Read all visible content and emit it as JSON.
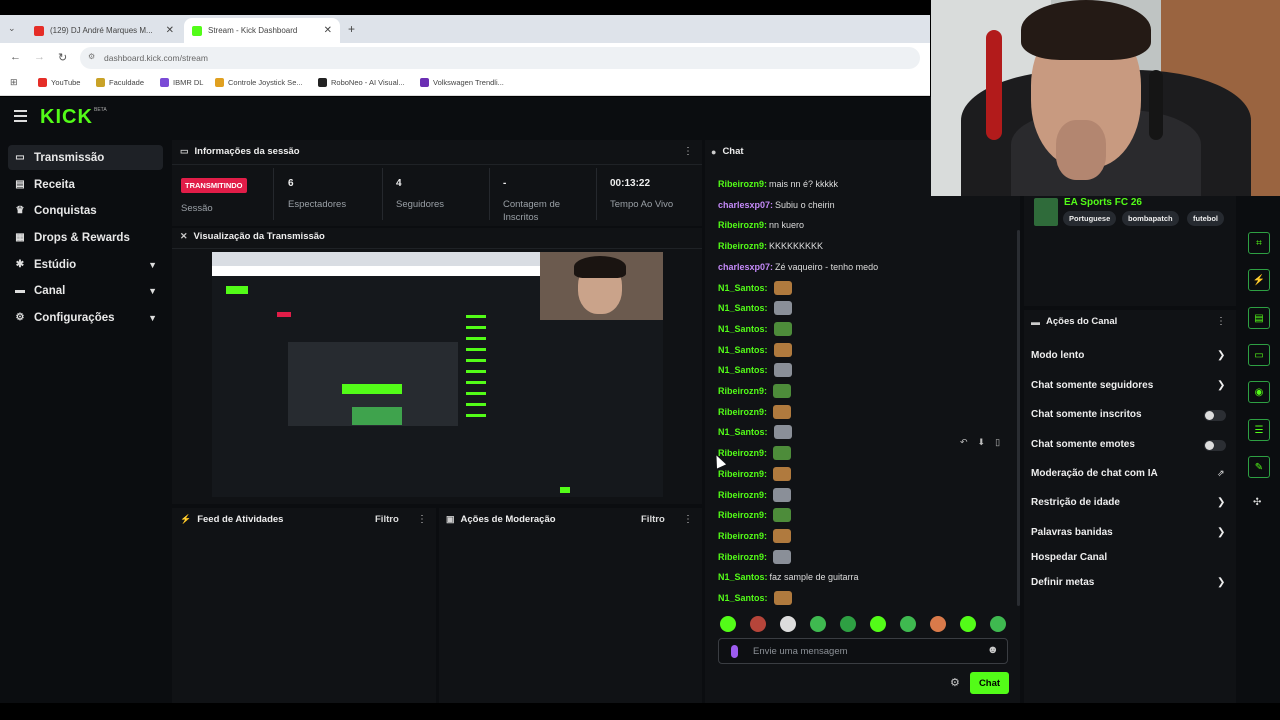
{
  "browser": {
    "tabs": [
      {
        "label": "(129) DJ André Marques M..."
      },
      {
        "label": "Stream - Kick Dashboard"
      }
    ],
    "new_tab": "+",
    "url": "dashboard.kick.com/stream",
    "bookmarks": [
      "YouTube",
      "Faculdade",
      "IBMR DL",
      "Controle Joystick Se...",
      "RoboNeo - AI Visual...",
      "Volkswagen Trendli..."
    ]
  },
  "app": {
    "logo": "KICK",
    "logo_badge": "BETA"
  },
  "sidebar": {
    "items": [
      {
        "label": "Transmissão",
        "icon": "broadcast-icon"
      },
      {
        "label": "Receita",
        "icon": "revenue-icon"
      },
      {
        "label": "Conquistas",
        "icon": "trophy-icon"
      },
      {
        "label": "Drops & Rewards",
        "icon": "gift-icon"
      },
      {
        "label": "Estúdio",
        "icon": "studio-icon"
      },
      {
        "label": "Canal",
        "icon": "channel-icon"
      },
      {
        "label": "Configurações",
        "icon": "gear-icon"
      }
    ]
  },
  "session": {
    "title": "Informações da sessão",
    "live_badge": "TRANSMITINDO",
    "session_label": "Sessão",
    "viewers_value": "6",
    "viewers_label": "Espectadores",
    "followers_value": "4",
    "followers_label": "Seguidores",
    "subs_value": "-",
    "subs_label": "Contagem de Inscritos",
    "uptime_value": "00:13:22",
    "uptime_label": "Tempo Ao Vivo"
  },
  "preview": {
    "title": "Visualização da Transmissão"
  },
  "activity": {
    "title": "Feed de Atividades",
    "filter": "Filtro"
  },
  "moderation": {
    "title": "Ações de Moderação",
    "filter": "Filtro"
  },
  "chat": {
    "title": "Chat",
    "messages": [
      {
        "user": "Ribeirozn9:",
        "text": "mais nn é? kkkkk",
        "color": "green"
      },
      {
        "user": "charlesxp07:",
        "text": "Subiu o cheirin",
        "color": "purple"
      },
      {
        "user": "Ribeirozn9:",
        "text": "nn kuero",
        "color": "green"
      },
      {
        "user": "Ribeirozn9:",
        "text": "KKKKKKKKK",
        "color": "green"
      },
      {
        "user": "charlesxp07:",
        "text": "Zé vaqueiro - tenho medo",
        "color": "purple"
      },
      {
        "user": "N1_Santos:",
        "text": "",
        "color": "green"
      },
      {
        "user": "N1_Santos:",
        "text": "",
        "color": "green"
      },
      {
        "user": "N1_Santos:",
        "text": "",
        "color": "green"
      },
      {
        "user": "N1_Santos:",
        "text": "",
        "color": "green"
      },
      {
        "user": "N1_Santos:",
        "text": "",
        "color": "green"
      },
      {
        "user": "Ribeirozn9:",
        "text": "",
        "color": "green"
      },
      {
        "user": "Ribeirozn9:",
        "text": "",
        "color": "green"
      },
      {
        "user": "N1_Santos:",
        "text": "",
        "color": "green"
      },
      {
        "user": "Ribeirozn9:",
        "text": "",
        "color": "green"
      },
      {
        "user": "Ribeirozn9:",
        "text": "",
        "color": "green"
      },
      {
        "user": "Ribeirozn9:",
        "text": "",
        "color": "green"
      },
      {
        "user": "Ribeirozn9:",
        "text": "",
        "color": "green"
      },
      {
        "user": "Ribeirozn9:",
        "text": "",
        "color": "green"
      },
      {
        "user": "Ribeirozn9:",
        "text": "",
        "color": "green"
      },
      {
        "user": "N1_Santos:",
        "text": "faz sample de guitarra",
        "color": "green"
      },
      {
        "user": "N1_Santos:",
        "text": "",
        "color": "green"
      }
    ],
    "input_placeholder": "Envie uma mensagem",
    "send_label": "Chat"
  },
  "stream_info": {
    "category": "EA Sports FC 26",
    "tags": [
      "Portuguese",
      "bombapatch",
      "futebol"
    ]
  },
  "channel_actions": {
    "title": "Ações do Canal",
    "items": [
      {
        "label": "Modo lento",
        "control": "chevron"
      },
      {
        "label": "Chat somente seguidores",
        "control": "chevron"
      },
      {
        "label": "Chat somente inscritos",
        "control": "toggle"
      },
      {
        "label": "Chat somente emotes",
        "control": "toggle"
      },
      {
        "label": "Moderação de chat com IA",
        "control": "external"
      },
      {
        "label": "Restrição de idade",
        "control": "chevron"
      },
      {
        "label": "Palavras banidas",
        "control": "chevron"
      },
      {
        "label": "Hospedar Canal",
        "control": "none"
      },
      {
        "label": "Definir metas",
        "control": "chevron"
      }
    ]
  },
  "colors": {
    "brand": "#53fc18",
    "live": "#e11d48",
    "purple_user": "#c58af9"
  }
}
